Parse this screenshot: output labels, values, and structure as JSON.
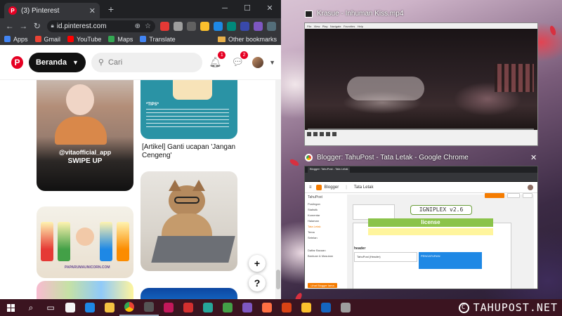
{
  "left_window": {
    "tab_title": "(3) Pinterest",
    "tab_favicon": "P",
    "url": "id.pinterest.com",
    "bookmarks": [
      {
        "label": "Apps",
        "color": "#4285f4"
      },
      {
        "label": "Gmail",
        "color": "#ea4335"
      },
      {
        "label": "YouTube",
        "color": "#ff0000"
      },
      {
        "label": "Maps",
        "color": "#34a853"
      },
      {
        "label": "Translate",
        "color": "#4285f4"
      }
    ],
    "other_bookmarks": "Other bookmarks",
    "extension_colors": [
      "#e53935",
      "#9e9e9e",
      "#616161",
      "#fbc02d",
      "#1e88e5",
      "#00897b",
      "#3949ab",
      "#7e57c2",
      "#546e7a"
    ]
  },
  "pinterest": {
    "home_label": "Beranda",
    "search_placeholder": "Cari",
    "notifications_count": "1",
    "messages_count": "2",
    "pins": {
      "girl_handle": "@vitaofficial_app",
      "girl_swipe": "SWIPE UP",
      "article_caption": "[Artikel] Ganti ucapan 'Jangan Cengeng'",
      "article_tips_heading": "*TIPS*",
      "kids_site": "PAPARUMAUNICORN.COM"
    },
    "fab_plus": "+",
    "fab_help": "?"
  },
  "player": {
    "title": "Krasue - Inhuman Kiss.mp4"
  },
  "blogger_window": {
    "title": "Blogger: TahuPost - Tata Letak - Google Chrome",
    "tab_label": "Blogger: TahuPost - Tata Letak",
    "app_name": "Blogger",
    "page_name": "Tata Letak",
    "blog_name": "TahuPost",
    "sidebar_items": [
      "Postingan",
      "Statistik",
      "Komentar",
      "Halaman",
      "Tata Letak",
      "Tema",
      "Setelan",
      "Daftar Bacaan",
      "Bantuan & Masukan"
    ],
    "view_blog_button": "Lihat Blogger lama",
    "theme_name": "IGNIPLEX v2.6",
    "license_label": "license",
    "header_label": "header",
    "widget_label": "TahuPost (Header)",
    "blue_widget_label": "PENGATURAN"
  },
  "watermark": "TAHUPOST.NET",
  "taskbar_icons": [
    {
      "name": "search-icon",
      "glyph": "⌕",
      "color": ""
    },
    {
      "name": "task-view-icon",
      "glyph": "▭",
      "color": ""
    },
    {
      "name": "store-icon",
      "glyph": "",
      "color": "#f4f4f4"
    },
    {
      "name": "edge-icon",
      "glyph": "",
      "color": "#1e88e5"
    },
    {
      "name": "explorer-icon",
      "glyph": "",
      "color": "#f5c242"
    },
    {
      "name": "chrome-icon",
      "glyph": "",
      "color": "#ea4335"
    },
    {
      "name": "media-player-icon",
      "glyph": "",
      "color": "#555555"
    },
    {
      "name": "anime-app-icon",
      "glyph": "",
      "color": "#c2185b"
    },
    {
      "name": "capcut-icon",
      "glyph": "",
      "color": "#d32f2f"
    },
    {
      "name": "video-editor-icon",
      "glyph": "",
      "color": "#26a69a"
    },
    {
      "name": "sheets-icon",
      "glyph": "",
      "color": "#43a047"
    },
    {
      "name": "ai-app-icon",
      "glyph": "",
      "color": "#7e57c2"
    },
    {
      "name": "orange-app-icon",
      "glyph": "",
      "color": "#ff7043"
    },
    {
      "name": "powerpoint-icon",
      "glyph": "",
      "color": "#d84315"
    },
    {
      "name": "paint-icon",
      "glyph": "",
      "color": "#fbc02d"
    },
    {
      "name": "word-icon",
      "glyph": "",
      "color": "#1565c0"
    },
    {
      "name": "settings-icon",
      "glyph": "",
      "color": "#9e9e9e"
    }
  ]
}
